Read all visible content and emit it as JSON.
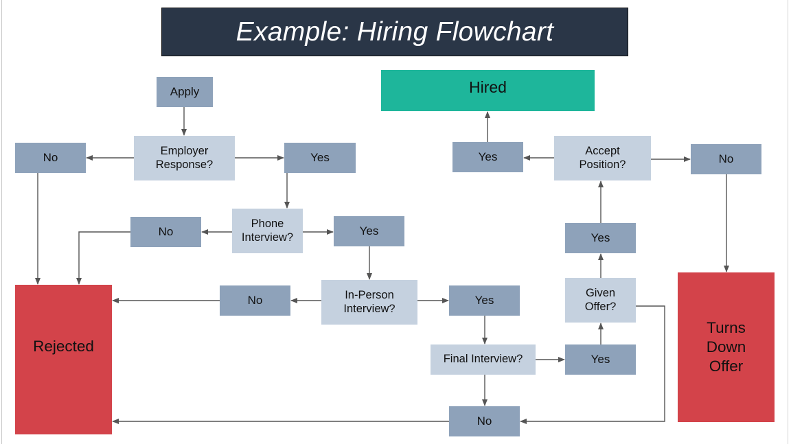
{
  "title": "Example: Hiring Flowchart",
  "colors": {
    "title_bg": "#2a3647",
    "outcome_box": "#8ea2ba",
    "question_box": "#c5d1df",
    "hired": "#1eb69b",
    "rejected": "#d3434a",
    "connector": "#555555"
  },
  "nodes": {
    "apply": "Apply",
    "employer_response": "Employer Response?",
    "employer_no": "No",
    "employer_yes": "Yes",
    "phone_interview": "Phone Interview?",
    "phone_no": "No",
    "phone_yes": "Yes",
    "in_person_interview": "In-Person Interview?",
    "in_person_no": "No",
    "in_person_yes": "Yes",
    "final_interview": "Final Interview?",
    "final_no": "No",
    "final_yes": "Yes",
    "given_offer": "Given Offer?",
    "offer_yes": "Yes",
    "accept_position": "Accept Position?",
    "accept_yes": "Yes",
    "accept_no": "No",
    "hired": "Hired",
    "rejected": "Rejected",
    "turns_down_offer": "Turns Down Offer"
  },
  "edges": [
    [
      "apply",
      "employer_response"
    ],
    [
      "employer_response",
      "employer_no"
    ],
    [
      "employer_response",
      "employer_yes"
    ],
    [
      "employer_no",
      "rejected"
    ],
    [
      "employer_yes",
      "phone_interview"
    ],
    [
      "phone_interview",
      "phone_no"
    ],
    [
      "phone_interview",
      "phone_yes"
    ],
    [
      "phone_no",
      "rejected"
    ],
    [
      "phone_yes",
      "in_person_interview"
    ],
    [
      "in_person_interview",
      "in_person_no"
    ],
    [
      "in_person_interview",
      "in_person_yes"
    ],
    [
      "in_person_no",
      "rejected"
    ],
    [
      "in_person_yes",
      "final_interview"
    ],
    [
      "final_interview",
      "final_no"
    ],
    [
      "final_interview",
      "final_yes"
    ],
    [
      "final_no",
      "rejected"
    ],
    [
      "final_yes",
      "given_offer"
    ],
    [
      "given_offer",
      "offer_yes"
    ],
    [
      "given_offer",
      "final_no"
    ],
    [
      "offer_yes",
      "accept_position"
    ],
    [
      "accept_position",
      "accept_yes"
    ],
    [
      "accept_position",
      "accept_no"
    ],
    [
      "accept_yes",
      "hired"
    ],
    [
      "accept_no",
      "turns_down_offer"
    ]
  ]
}
